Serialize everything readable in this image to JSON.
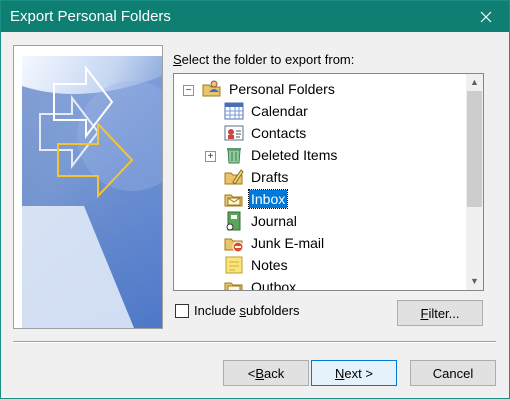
{
  "window": {
    "title": "Export Personal Folders",
    "accent_color": "#0f7f73"
  },
  "prompt": {
    "before": "",
    "mnemonic": "S",
    "after": "elect the folder to export from:"
  },
  "tree": {
    "root": {
      "label": "Personal Folders",
      "icon": "personal-folders-icon",
      "expander": "−"
    },
    "items": [
      {
        "label": "Calendar",
        "icon": "calendar-icon"
      },
      {
        "label": "Contacts",
        "icon": "contacts-icon"
      },
      {
        "label": "Deleted Items",
        "icon": "deleted-items-icon",
        "expander": "+"
      },
      {
        "label": "Drafts",
        "icon": "drafts-icon"
      },
      {
        "label": "Inbox",
        "icon": "inbox-icon",
        "selected": true
      },
      {
        "label": "Journal",
        "icon": "journal-icon"
      },
      {
        "label": "Junk E-mail",
        "icon": "junk-email-icon"
      },
      {
        "label": "Notes",
        "icon": "notes-icon"
      },
      {
        "label": "Outbox",
        "icon": "outbox-icon"
      }
    ],
    "selected_color": "#0078d7"
  },
  "include_subfolders": {
    "before": "Include ",
    "mnemonic": "s",
    "after": "ubfolders",
    "checked": false
  },
  "buttons": {
    "filter": {
      "before": "",
      "mnemonic": "F",
      "after": "ilter..."
    },
    "back": {
      "before": "< ",
      "mnemonic": "B",
      "after": "ack"
    },
    "next": {
      "before": "",
      "mnemonic": "N",
      "after": "ext >"
    },
    "cancel": {
      "label": "Cancel"
    }
  }
}
